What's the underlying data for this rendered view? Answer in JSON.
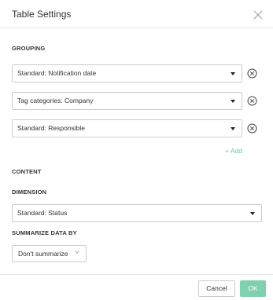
{
  "dialog": {
    "title": "Table Settings"
  },
  "grouping": {
    "heading": "GROUPING",
    "rows": [
      {
        "value": "Standard: Notification date"
      },
      {
        "value": "Tag categories: Company"
      },
      {
        "value": "Standard: Responsible"
      }
    ],
    "add_label": "+ Add"
  },
  "content": {
    "heading": "CONTENT",
    "dimension_heading": "DIMENSION",
    "dimension_value": "Standard: Status",
    "summarize_heading": "SUMMARIZE DATA BY",
    "summarize_value": "Don't summarize"
  },
  "footer": {
    "cancel_label": "Cancel",
    "ok_label": "OK"
  },
  "colors": {
    "accent": "#7fd0ae",
    "add_link": "#6cc3a0",
    "border": "#cccccc"
  },
  "icons": {
    "close": "close-icon",
    "remove": "remove-circle-icon",
    "caret": "caret-down-icon",
    "chevron": "chevron-down-icon"
  }
}
